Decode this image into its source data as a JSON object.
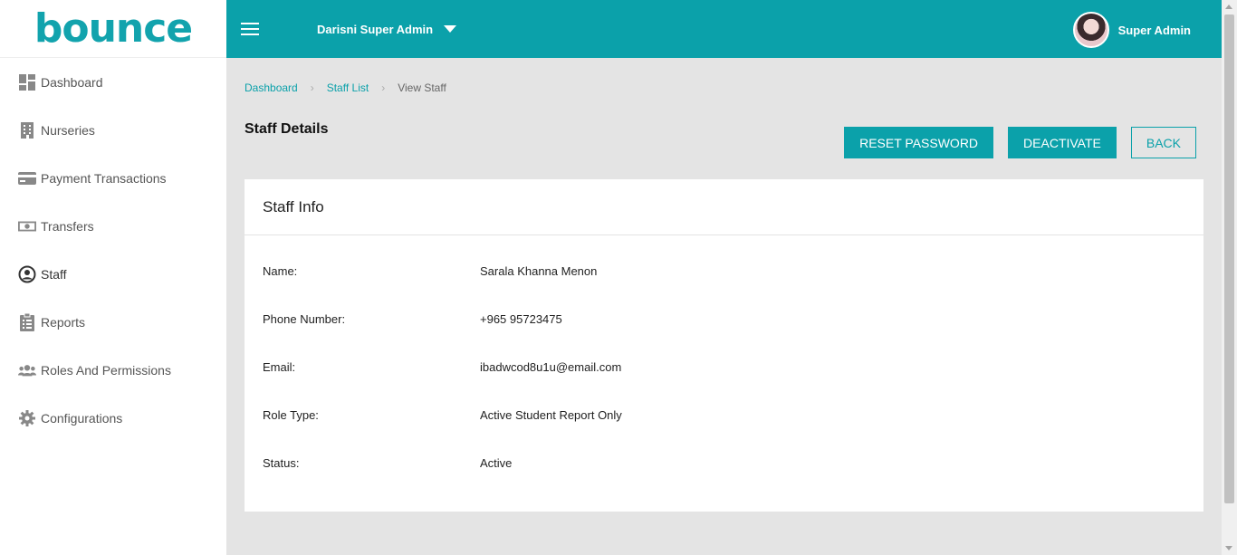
{
  "brand": {
    "logo_text": "bounce"
  },
  "sidebar": {
    "items": [
      {
        "label": "Dashboard",
        "icon": "dashboard-icon"
      },
      {
        "label": "Nurseries",
        "icon": "building-icon"
      },
      {
        "label": "Payment Transactions",
        "icon": "credit-card-icon"
      },
      {
        "label": "Transfers",
        "icon": "money-icon"
      },
      {
        "label": "Staff",
        "icon": "user-circle-icon"
      },
      {
        "label": "Reports",
        "icon": "clipboard-icon"
      },
      {
        "label": "Roles And Permissions",
        "icon": "users-icon"
      },
      {
        "label": "Configurations",
        "icon": "gear-icon"
      }
    ]
  },
  "topbar": {
    "org_name": "Darisni Super Admin",
    "user_name": "Super Admin"
  },
  "breadcrumb": {
    "items": [
      "Dashboard",
      "Staff List"
    ],
    "current": "View Staff"
  },
  "page": {
    "title": "Staff Details"
  },
  "actions": {
    "reset_password": "RESET PASSWORD",
    "deactivate": "DEACTIVATE",
    "back": "BACK"
  },
  "card": {
    "title": "Staff Info",
    "fields": [
      {
        "label": "Name:",
        "value": "Sarala Khanna Menon"
      },
      {
        "label": "Phone Number:",
        "value": "+965 95723475"
      },
      {
        "label": "Email:",
        "value": "ibadwcod8u1u@email.com"
      },
      {
        "label": "Role Type:",
        "value": "Active Student Report Only"
      },
      {
        "label": "Status:",
        "value": "Active"
      }
    ]
  },
  "colors": {
    "accent": "#0ba1aa",
    "background": "#e4e4e4",
    "logo_dot": "#f5c400"
  }
}
